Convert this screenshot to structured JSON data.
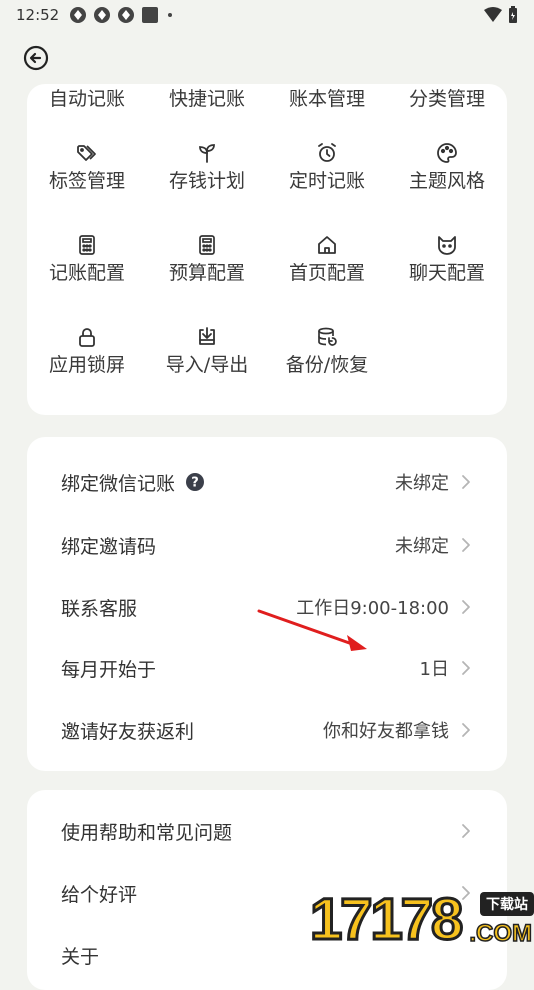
{
  "status_bar": {
    "time": "12:52"
  },
  "grid": {
    "items": [
      {
        "label": "自动记账",
        "icon": "auto-record-icon"
      },
      {
        "label": "快捷记账",
        "icon": "quick-record-icon"
      },
      {
        "label": "账本管理",
        "icon": "ledger-icon"
      },
      {
        "label": "分类管理",
        "icon": "category-icon"
      },
      {
        "label": "标签管理",
        "icon": "tags-icon"
      },
      {
        "label": "存钱计划",
        "icon": "sprout-icon"
      },
      {
        "label": "定时记账",
        "icon": "alarm-clock-icon"
      },
      {
        "label": "主题风格",
        "icon": "palette-icon"
      },
      {
        "label": "记账配置",
        "icon": "calculator-icon"
      },
      {
        "label": "预算配置",
        "icon": "calculator-icon"
      },
      {
        "label": "首页配置",
        "icon": "home-icon"
      },
      {
        "label": "聊天配置",
        "icon": "cat-icon"
      },
      {
        "label": "应用锁屏",
        "icon": "lock-icon"
      },
      {
        "label": "导入/导出",
        "icon": "import-export-icon"
      },
      {
        "label": "备份/恢复",
        "icon": "database-backup-icon"
      }
    ]
  },
  "settings_list": [
    {
      "label": "绑定微信记账",
      "value": "未绑定",
      "has_help": true
    },
    {
      "label": "绑定邀请码",
      "value": "未绑定"
    },
    {
      "label": "联系客服",
      "value": "工作日9:00-18:00"
    },
    {
      "label": "每月开始于",
      "value": "1日"
    },
    {
      "label": "邀请好友获返利",
      "value": "你和好友都拿钱"
    }
  ],
  "help_list": [
    {
      "label": "使用帮助和常见问题"
    },
    {
      "label": "给个好评"
    },
    {
      "label": "关于"
    }
  ],
  "watermark": {
    "digits": "17178",
    "badge": "下载站",
    "domain": ".COM"
  },
  "colors": {
    "background": "#f2f3ef",
    "card": "#ffffff",
    "arrow": "#e01e1e"
  }
}
